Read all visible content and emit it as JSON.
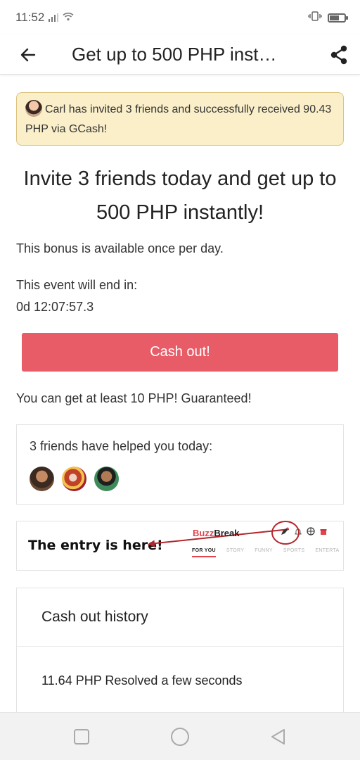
{
  "status": {
    "time": "11:52",
    "icons": [
      "signal-icon",
      "wifi-icon",
      "vibrate-icon",
      "battery-icon"
    ]
  },
  "header": {
    "title": "Get up to 500 PHP inst…",
    "back_icon": "back-arrow-icon",
    "share_icon": "share-icon"
  },
  "banner": {
    "text": "Carl has invited 3 friends and successfully received 90.43 PHP via GCash!"
  },
  "main": {
    "headline": "Invite 3 friends today and get up to 500 PHP instantly!",
    "bonus_note": "This bonus is available once per day.",
    "event_label": "This event will end in:",
    "countdown": "0d 12:07:57.3",
    "cashout_button": "Cash out!",
    "guarantee": "You can get at least 10 PHP! Guaranteed!"
  },
  "friends": {
    "title": "3 friends have helped you today:"
  },
  "entry": {
    "text": "The entry is here!",
    "logo_buzz": "Buzz",
    "logo_break": "Break",
    "tabs": [
      "FOR YOU",
      "STORY",
      "FUNNY",
      "SPORTS",
      "ENTERTA"
    ]
  },
  "history": {
    "title": "Cash out history",
    "items": [
      "11.64 PHP Resolved a few seconds"
    ]
  },
  "colors": {
    "accent": "#e85c68",
    "banner_bg": "#fbefc9",
    "annotation": "#b3262d"
  }
}
